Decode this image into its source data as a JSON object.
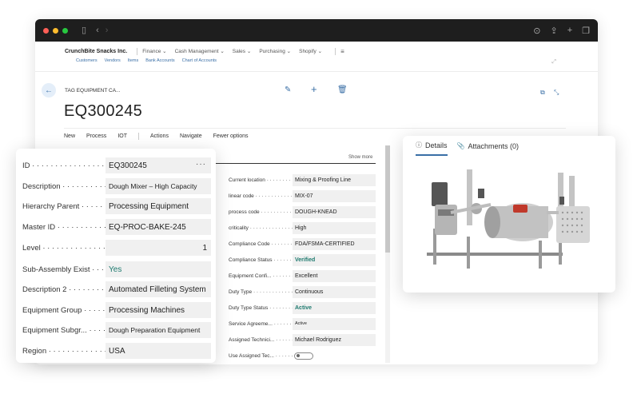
{
  "app": {
    "company": "CrunchBite Snacks Inc.",
    "menu": [
      "Finance",
      "Cash Management",
      "Sales",
      "Purchasing",
      "Shopify"
    ],
    "links": [
      "Customers",
      "Vendors",
      "Items",
      "Bank Accounts",
      "Chart of Accounts"
    ]
  },
  "page": {
    "breadcrumb": "TAG EQUIPMENT CA...",
    "title": "EQ300245",
    "actions": [
      "New",
      "Process",
      "IOT",
      "Actions",
      "Navigate",
      "Fewer options"
    ],
    "show_more": "Show more"
  },
  "left_fields": [
    {
      "label": "ID",
      "value": "EQ300245"
    },
    {
      "label": "Description",
      "value": "Dough Mixer – High Capacity"
    },
    {
      "label": "Hierarchy Parent",
      "value": "Processing Equipment"
    },
    {
      "label": "Master ID",
      "value": "EQ-PROC-BAKE-245"
    },
    {
      "label": "Level",
      "value": "1"
    },
    {
      "label": "Sub-Assembly Exist",
      "value": "Yes"
    },
    {
      "label": "Description 2",
      "value": "Automated Filleting System"
    },
    {
      "label": "Equipment Group",
      "value": "Processing Machines"
    },
    {
      "label": "Equipment Subgr...",
      "value": "Dough Preparation Equipment"
    },
    {
      "label": "Region",
      "value": "USA"
    }
  ],
  "middle_fields": [
    {
      "label": "Current location",
      "value": "Mixing & Proofing Line"
    },
    {
      "label": "linear code",
      "value": "MIX-07"
    },
    {
      "label": "process code",
      "value": "DOUGH-KNEAD"
    },
    {
      "label": "criticality",
      "value": "High"
    },
    {
      "label": "Compliance Code",
      "value": "FDA/FSMA-CERTIFIED"
    },
    {
      "label": "Compliance Status",
      "value": "Verified"
    },
    {
      "label": "Equipment Confi...",
      "value": "Excellent"
    },
    {
      "label": "Duty Type",
      "value": "Continuous"
    },
    {
      "label": "Duty Type Status",
      "value": "Active"
    },
    {
      "label": "Service Agreeme...",
      "value": "Active"
    },
    {
      "label": "Assigned Technici...",
      "value": "Michael Rodriguez"
    },
    {
      "label": "Use Assigned Tec...",
      "value": ""
    }
  ],
  "details": {
    "tab_details": "Details",
    "tab_attachments": "Attachments (0)"
  },
  "colors": {
    "accent": "#3a6fa6",
    "status": "#1e7a6f",
    "field_bg": "#f0f0f0"
  }
}
